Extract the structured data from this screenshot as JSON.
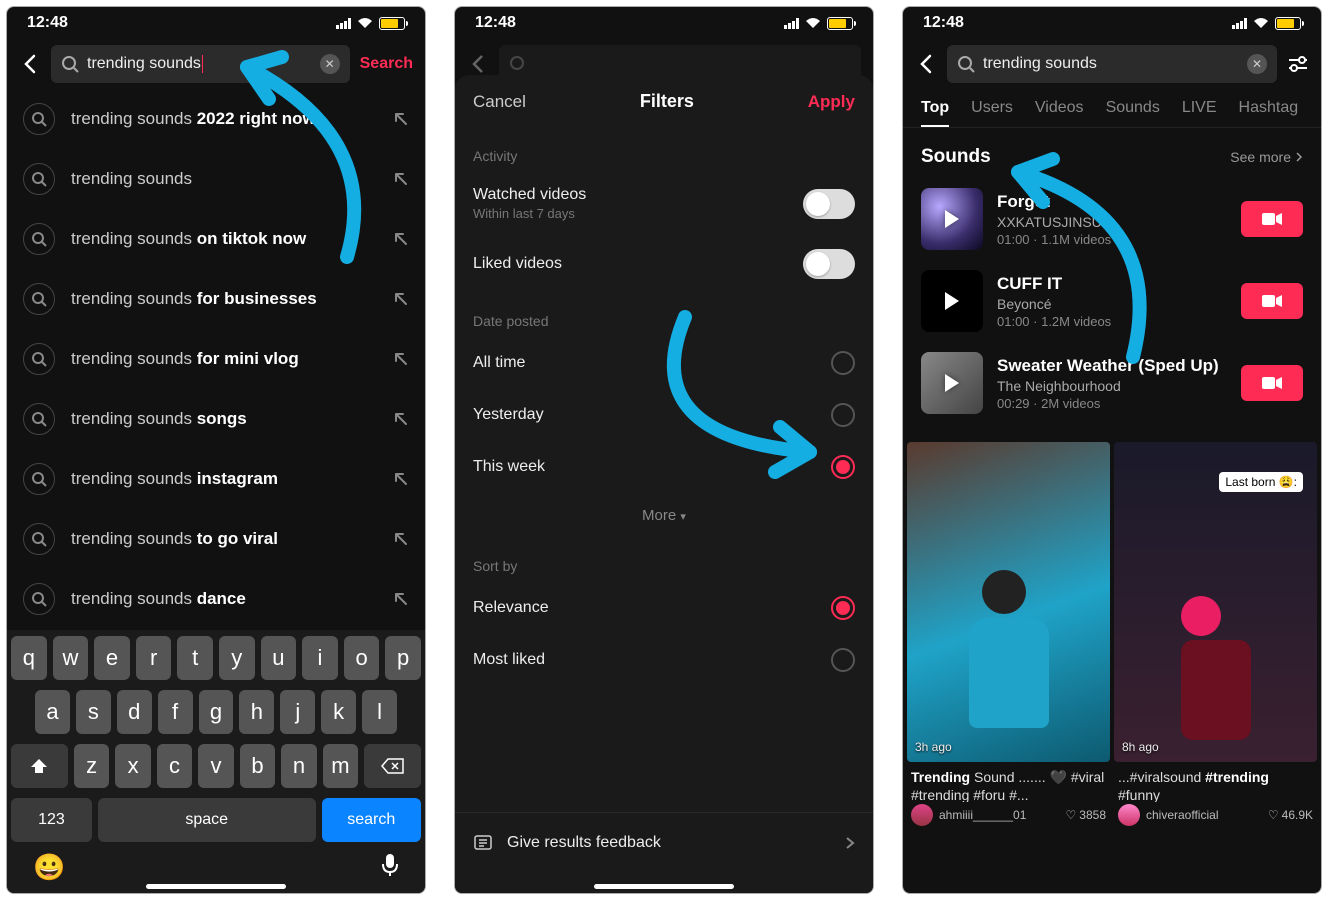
{
  "status": {
    "time": "12:48"
  },
  "screen1": {
    "search_value": "trending sounds",
    "search_action": "Search",
    "suggestions": [
      {
        "prefix": "trending sounds ",
        "bold": "2022 right now"
      },
      {
        "prefix": "trending sounds",
        "bold": ""
      },
      {
        "prefix": "trending sounds ",
        "bold": "on tiktok now"
      },
      {
        "prefix": "trending sounds ",
        "bold": "for businesses"
      },
      {
        "prefix": "trending sounds ",
        "bold": "for mini vlog"
      },
      {
        "prefix": "trending sounds ",
        "bold": "songs"
      },
      {
        "prefix": "trending sounds ",
        "bold": "instagram"
      },
      {
        "prefix": "trending sounds ",
        "bold": "to go viral"
      },
      {
        "prefix": "trending sounds ",
        "bold": "dance"
      }
    ],
    "keyboard": {
      "row1": [
        "q",
        "w",
        "e",
        "r",
        "t",
        "y",
        "u",
        "i",
        "o",
        "p"
      ],
      "row2": [
        "a",
        "s",
        "d",
        "f",
        "g",
        "h",
        "j",
        "k",
        "l"
      ],
      "row3": [
        "z",
        "x",
        "c",
        "v",
        "b",
        "n",
        "m"
      ],
      "num_key": "123",
      "space_key": "space",
      "search_key": "search"
    }
  },
  "screen2": {
    "cancel": "Cancel",
    "title": "Filters",
    "apply": "Apply",
    "activity_label": "Activity",
    "watched": "Watched videos",
    "watched_sub": "Within last 7 days",
    "liked": "Liked videos",
    "date_label": "Date posted",
    "all_time": "All time",
    "yesterday": "Yesterday",
    "this_week": "This week",
    "more": "More",
    "sort_label": "Sort by",
    "relevance": "Relevance",
    "most_liked": "Most liked",
    "feedback": "Give results feedback"
  },
  "screen3": {
    "search_value": "trending sounds",
    "tabs": [
      "Top",
      "Users",
      "Videos",
      "Sounds",
      "LIVE",
      "Hashtag"
    ],
    "sounds_heading": "Sounds",
    "see_more": "See more",
    "sounds": [
      {
        "title": "Forget",
        "artist": "XXKATUSJINSUX",
        "meta": "01:00 · 1.1M videos"
      },
      {
        "title": "CUFF IT",
        "artist": "Beyoncé",
        "meta": "01:00 · 1.2M videos"
      },
      {
        "title": "Sweater Weather (Sped Up)",
        "artist": "The Neighbourhood",
        "meta": "00:29 · 2M videos"
      }
    ],
    "videos": [
      {
        "ago": "3h ago",
        "caption_bold": "Trending",
        "caption_rest": " Sound ....... 🖤 #viral #trending #foru #...",
        "user": "ahmiiii______01",
        "likes": "3858"
      },
      {
        "ago": "8h ago",
        "overlay": "Last born 😩:",
        "caption_prefix": "...#viralsound ",
        "caption_bold": "#trending",
        "caption_rest2": " #funny",
        "user": "chiveraofficial",
        "likes": "46.9K"
      }
    ]
  }
}
